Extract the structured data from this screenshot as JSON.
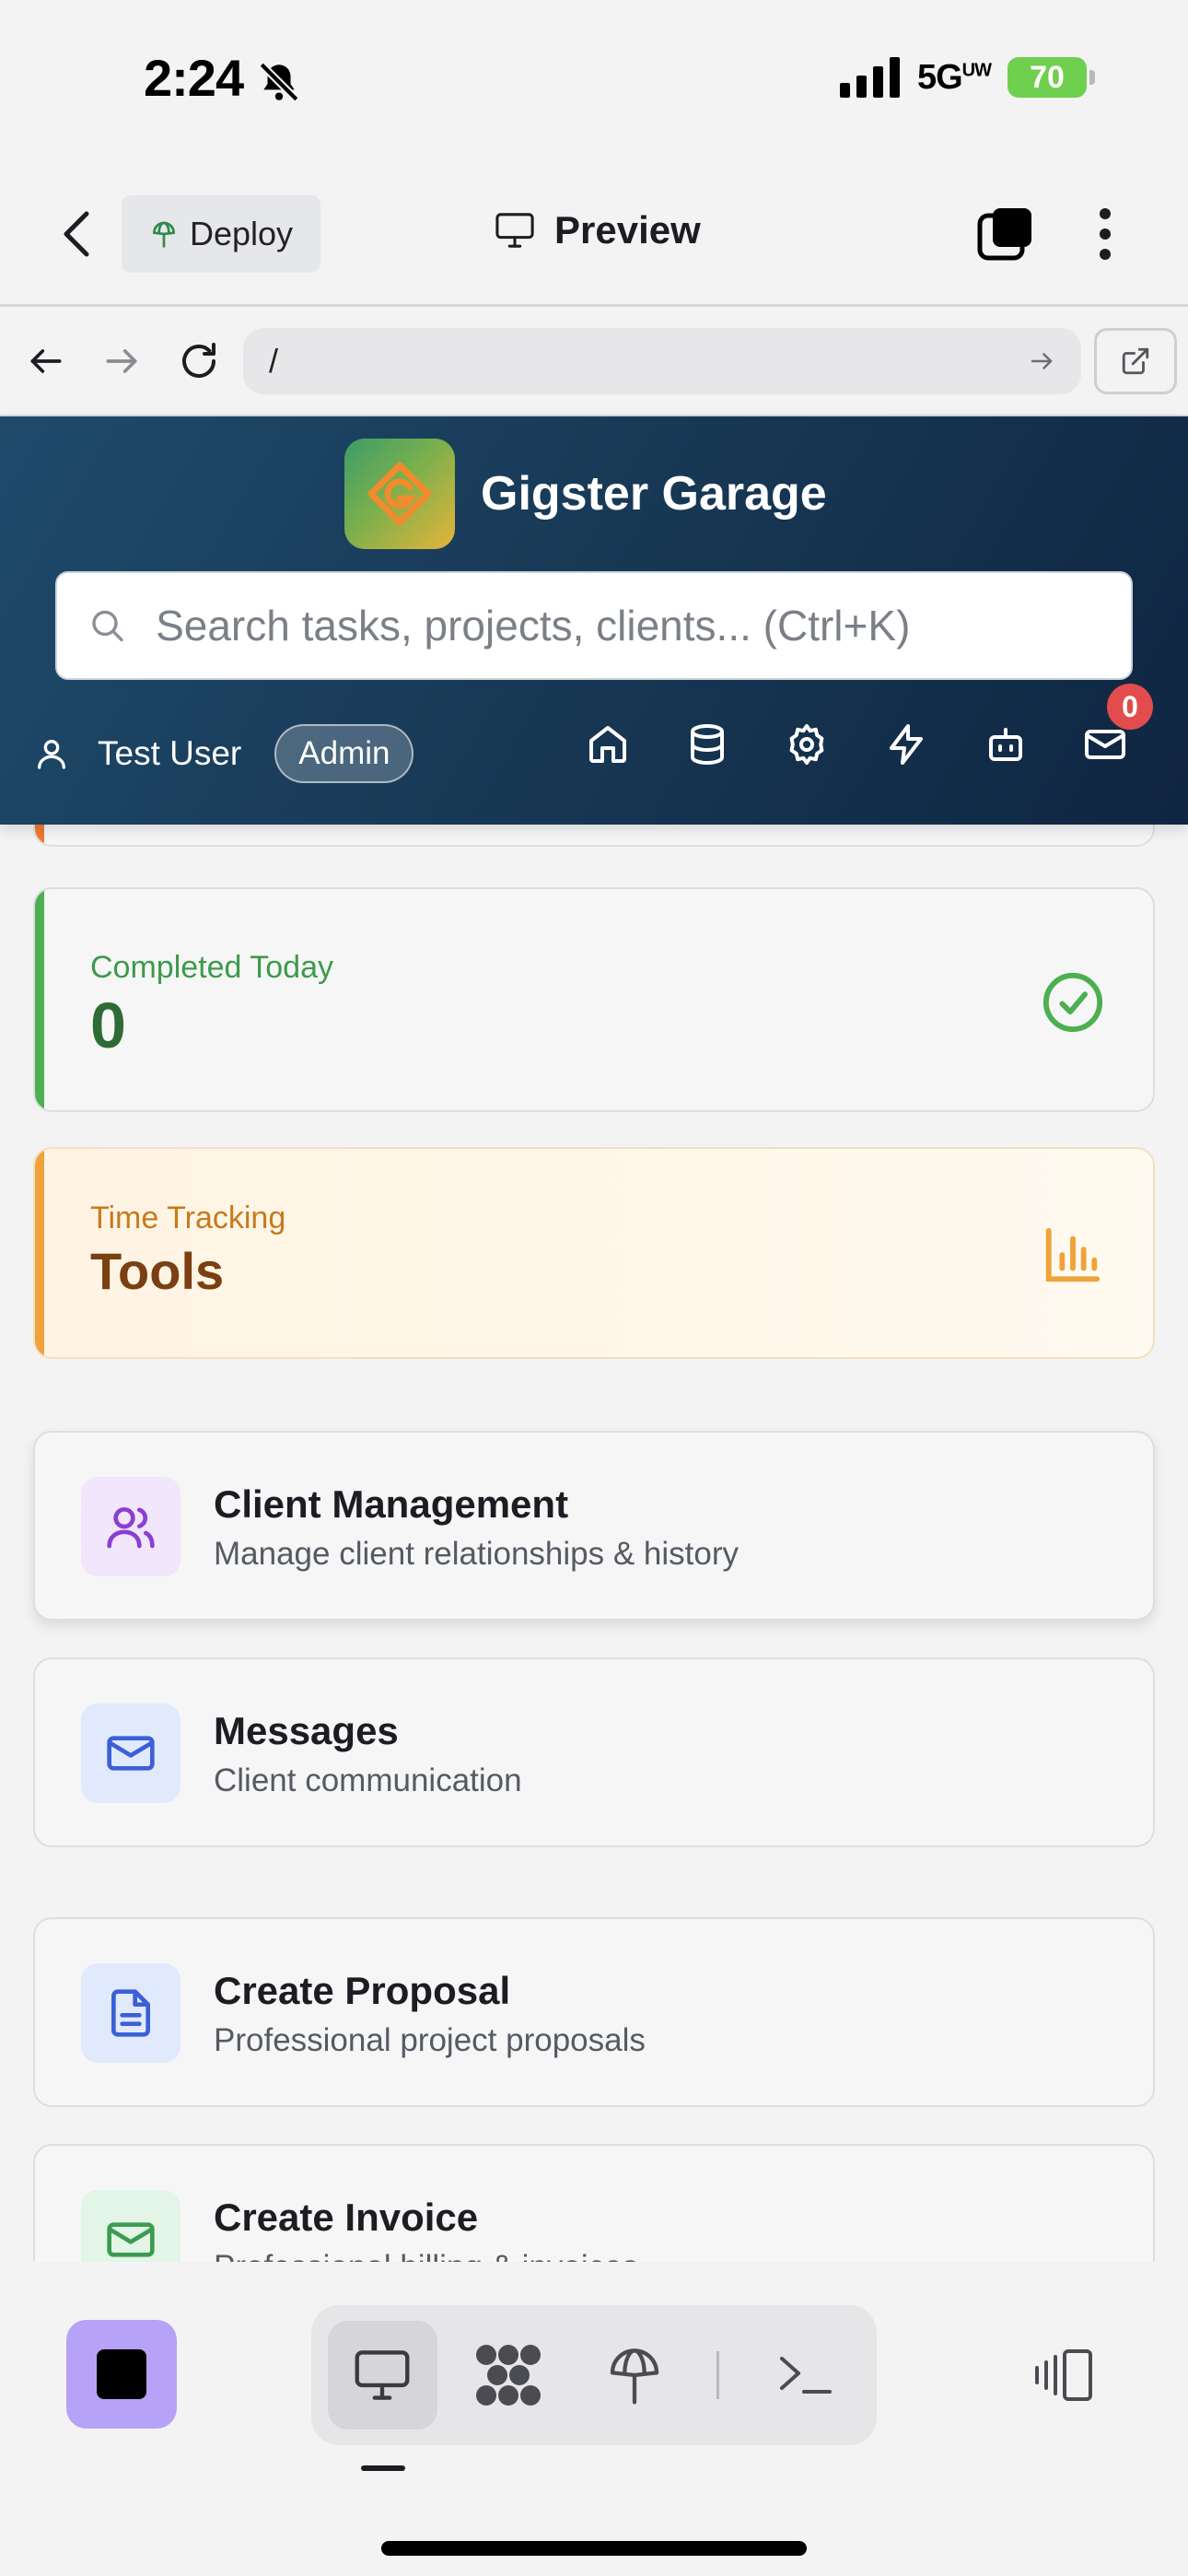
{
  "status_bar": {
    "time": "2:24",
    "network": "5G",
    "network_sup": "UW",
    "battery": "70"
  },
  "app_bar": {
    "deploy_label": "Deploy",
    "preview_label": "Preview"
  },
  "browser": {
    "url": "/"
  },
  "header": {
    "brand_name": "Gigster Garage",
    "search_placeholder": "Search tasks, projects, clients... (Ctrl+K)",
    "user_name": "Test User",
    "role": "Admin",
    "mail_count": "0"
  },
  "stats": [
    {
      "label": "Completed Today",
      "value": "0",
      "accent": "#4caf50",
      "label_color": "#3d9a4c",
      "value_color": "#2e6b35"
    },
    {
      "label": "Time Tracking",
      "value": "Tools",
      "accent": "#f0a33a",
      "label_color": "#c77a1e",
      "value_color": "#7a3f12"
    }
  ],
  "features": [
    {
      "title": "Client Management",
      "description": "Manage client relationships & history",
      "icon": "users-icon"
    },
    {
      "title": "Messages",
      "description": "Client communication",
      "icon": "mail-icon"
    },
    {
      "title": "Create Proposal",
      "description": "Professional project proposals",
      "icon": "document-icon"
    },
    {
      "title": "Create Invoice",
      "description": "Professional billing & invoices",
      "icon": "mail-icon"
    }
  ]
}
